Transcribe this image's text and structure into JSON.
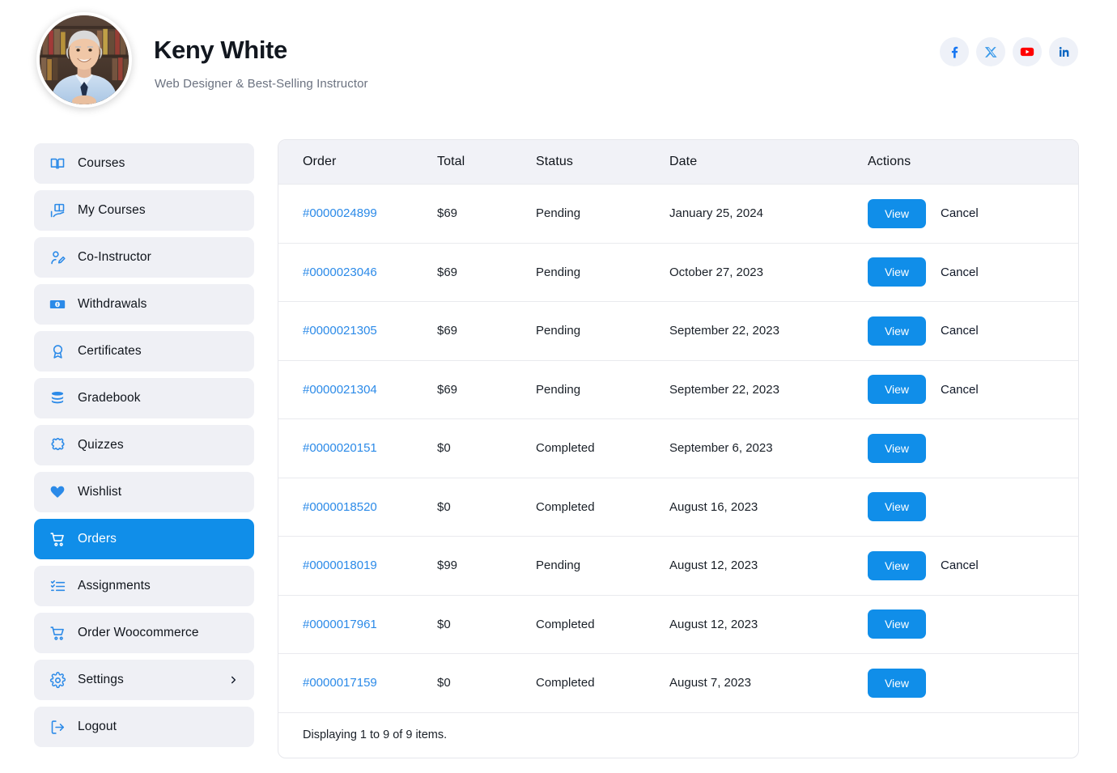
{
  "profile": {
    "name": "Keny White",
    "subtitle": "Web Designer & Best-Selling Instructor",
    "avatar_alt": "avatar-photo"
  },
  "social": [
    {
      "name": "facebook-icon",
      "label": "Facebook",
      "color": "#1877f2"
    },
    {
      "name": "x-twitter-icon",
      "label": "X",
      "color": "#3b9aea"
    },
    {
      "name": "youtube-icon",
      "label": "YouTube",
      "color": "#ff0000"
    },
    {
      "name": "linkedin-icon",
      "label": "LinkedIn",
      "color": "#0a66c2"
    }
  ],
  "sidebar": {
    "items": [
      {
        "label": "Courses",
        "icon": "book-open-icon",
        "active": false,
        "chevron": false
      },
      {
        "label": "My Courses",
        "icon": "my-courses-icon",
        "active": false,
        "chevron": false
      },
      {
        "label": "Co-Instructor",
        "icon": "user-edit-icon",
        "active": false,
        "chevron": false
      },
      {
        "label": "Withdrawals",
        "icon": "banknote-icon",
        "active": false,
        "chevron": false
      },
      {
        "label": "Certificates",
        "icon": "award-ribbon-icon",
        "active": false,
        "chevron": false
      },
      {
        "label": "Gradebook",
        "icon": "stacked-disks-icon",
        "active": false,
        "chevron": false
      },
      {
        "label": "Quizzes",
        "icon": "puzzle-piece-icon",
        "active": false,
        "chevron": false
      },
      {
        "label": "Wishlist",
        "icon": "heart-icon",
        "active": false,
        "chevron": false
      },
      {
        "label": "Orders",
        "icon": "shopping-cart-icon",
        "active": true,
        "chevron": false
      },
      {
        "label": "Assignments",
        "icon": "checklist-icon",
        "active": false,
        "chevron": false
      },
      {
        "label": "Order Woocommerce",
        "icon": "shopping-cart-icon",
        "active": false,
        "chevron": false
      },
      {
        "label": "Settings",
        "icon": "gear-icon",
        "active": false,
        "chevron": true
      },
      {
        "label": "Logout",
        "icon": "logout-icon",
        "active": false,
        "chevron": false
      }
    ]
  },
  "table": {
    "columns": [
      "Order",
      "Total",
      "Status",
      "Date",
      "Actions"
    ],
    "rows": [
      {
        "order": "#0000024899",
        "total": "$69",
        "status": "Pending",
        "date": "January 25, 2024",
        "view": "View",
        "cancel": "Cancel"
      },
      {
        "order": "#0000023046",
        "total": "$69",
        "status": "Pending",
        "date": "October 27, 2023",
        "view": "View",
        "cancel": "Cancel"
      },
      {
        "order": "#0000021305",
        "total": "$69",
        "status": "Pending",
        "date": "September 22, 2023",
        "view": "View",
        "cancel": "Cancel"
      },
      {
        "order": "#0000021304",
        "total": "$69",
        "status": "Pending",
        "date": "September 22, 2023",
        "view": "View",
        "cancel": "Cancel"
      },
      {
        "order": "#0000020151",
        "total": "$0",
        "status": "Completed",
        "date": "September 6, 2023",
        "view": "View",
        "cancel": ""
      },
      {
        "order": "#0000018520",
        "total": "$0",
        "status": "Completed",
        "date": "August 16, 2023",
        "view": "View",
        "cancel": ""
      },
      {
        "order": "#0000018019",
        "total": "$99",
        "status": "Pending",
        "date": "August 12, 2023",
        "view": "View",
        "cancel": "Cancel"
      },
      {
        "order": "#0000017961",
        "total": "$0",
        "status": "Completed",
        "date": "August 12, 2023",
        "view": "View",
        "cancel": ""
      },
      {
        "order": "#0000017159",
        "total": "$0",
        "status": "Completed",
        "date": "August 7, 2023",
        "view": "View",
        "cancel": ""
      }
    ],
    "footer": "Displaying 1 to 9 of 9 items."
  },
  "colors": {
    "accent": "#108ee9",
    "link": "#2b8ae8",
    "sidebar_item_bg": "#eff0f5",
    "table_header_bg": "#f1f2f7",
    "text": "#10151c",
    "muted": "#6b7280"
  }
}
